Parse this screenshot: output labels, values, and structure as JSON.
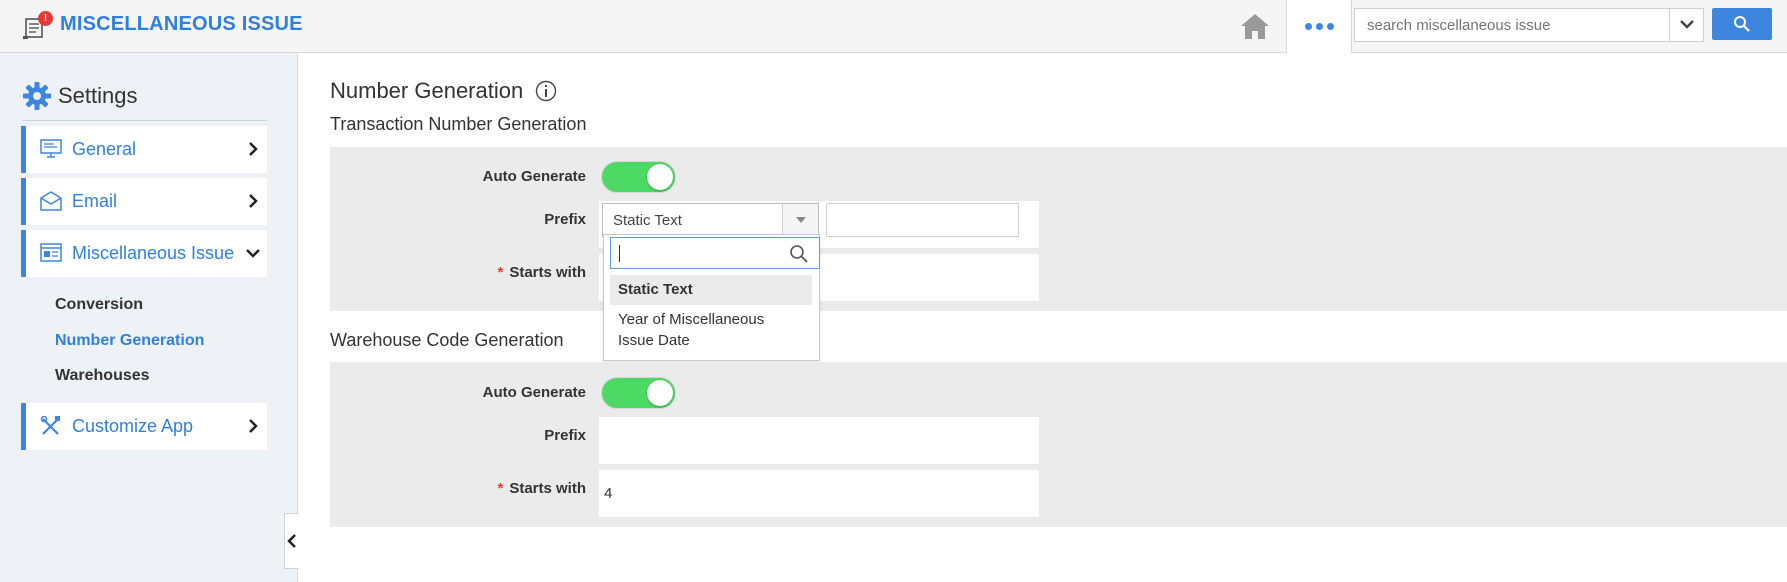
{
  "header": {
    "app_title": "MISCELLANEOUS ISSUE",
    "badge": "!",
    "search_placeholder": "search miscellaneous issue"
  },
  "sidebar": {
    "title": "Settings",
    "items": [
      {
        "label": "General",
        "icon": "monitor-icon",
        "state": "collapsed"
      },
      {
        "label": "Email",
        "icon": "envelope-icon",
        "state": "collapsed"
      },
      {
        "label": "Miscellaneous Issue",
        "icon": "form-icon",
        "state": "expanded"
      },
      {
        "label": "Customize App",
        "icon": "tools-icon",
        "state": "collapsed"
      }
    ],
    "sub_items": [
      {
        "label": "Conversion",
        "active": false
      },
      {
        "label": "Number Generation",
        "active": true
      },
      {
        "label": "Warehouses",
        "active": false
      }
    ]
  },
  "main": {
    "page_title": "Number Generation",
    "transaction": {
      "title": "Transaction Number Generation",
      "auto_generate_label": "Auto Generate",
      "auto_generate": true,
      "prefix_label": "Prefix",
      "prefix_selected": "Static Text",
      "prefix_text": "",
      "starts_with_label": "Starts with",
      "dropdown_options": [
        "Static Text",
        "Year of Miscellaneous Issue Date"
      ]
    },
    "warehouse": {
      "title": "Warehouse Code Generation",
      "auto_generate_label": "Auto Generate",
      "auto_generate": true,
      "prefix_label": "Prefix",
      "starts_with_label": "Starts with",
      "starts_with_value": "4"
    }
  },
  "colors": {
    "accent": "#3d86e0",
    "toggle_on": "#4cd964",
    "required": "#e53935"
  }
}
